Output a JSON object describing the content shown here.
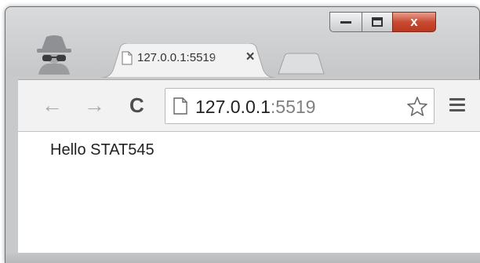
{
  "tab": {
    "title": "127.0.0.1:5519",
    "close_glyph": "×"
  },
  "controls": {
    "close_glyph": "x"
  },
  "toolbar": {
    "back_glyph": "←",
    "forward_glyph": "→",
    "reload_glyph": "C"
  },
  "omnibox": {
    "host": "127.0.0.1",
    "port": ":5519"
  },
  "page": {
    "text": "Hello STAT545"
  },
  "icons": {
    "incognito": "incognito-icon",
    "favicon": "page-icon",
    "bookmark": "star-icon",
    "menu": "menu-icon"
  },
  "colors": {
    "close_button": "#c94a30",
    "frame": "#c7c9cb",
    "toolbar": "#f2f2f2"
  }
}
